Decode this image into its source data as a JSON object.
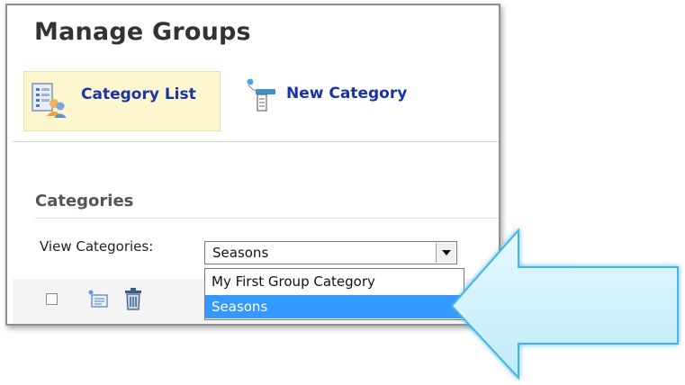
{
  "page": {
    "title": "Manage Groups"
  },
  "toolbar": {
    "category_list_label": "Category List",
    "new_category_label": "New Category"
  },
  "section": {
    "title": "Categories"
  },
  "filter": {
    "label": "View Categories:",
    "selected_value": "Seasons",
    "options": [
      "My First Group Category",
      "Seasons"
    ]
  },
  "colors": {
    "link": "#1a33a8",
    "highlight": "#3399ff",
    "active_tab_bg": "#fdf6cf",
    "callout_arrow": "#d4f3fb"
  },
  "icons": {
    "category_list": "list-users-icon",
    "new_category": "add-list-icon",
    "add_row": "add-row-icon",
    "delete": "trash-icon",
    "dropdown": "dropdown-arrow-icon",
    "callout": "callout-arrow-icon"
  }
}
